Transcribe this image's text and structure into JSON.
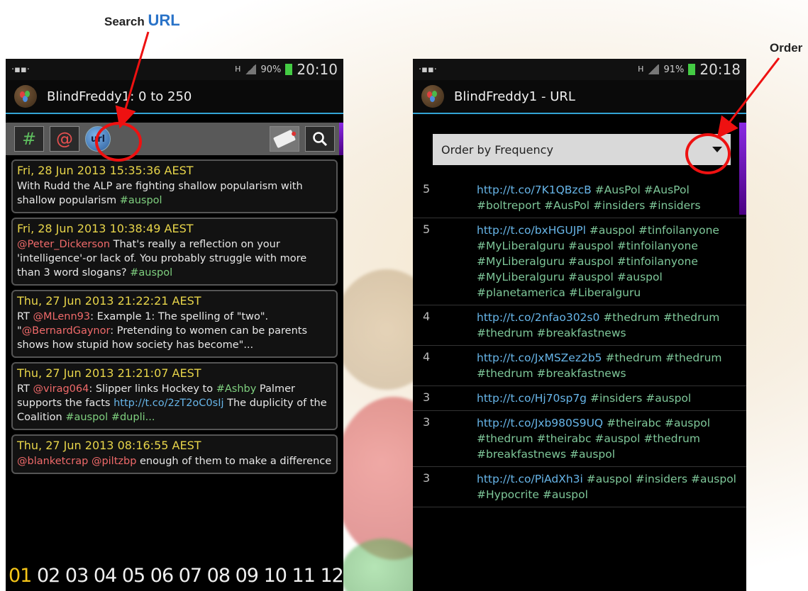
{
  "annotations": {
    "search_label": "Search",
    "url_label": "URL",
    "order_label": "Order"
  },
  "left_screen": {
    "status": {
      "network": "H",
      "battery": "90%",
      "time": "20:10"
    },
    "title": "BlindFreddy1: 0 to 250",
    "toolbar": {
      "hash_label": "#",
      "at_label": "@",
      "url_label": "url",
      "label_icon": "label-tag-icon",
      "search_icon": "search-icon"
    },
    "tweets": [
      {
        "date": "Fri, 28 Jun 2013 15:35:36 AEST",
        "parts": [
          {
            "t": "With Rudd the ALP are fighting shallow popularism with shallow popularism ",
            "c": ""
          },
          {
            "t": "#auspol",
            "c": "c-hash"
          }
        ]
      },
      {
        "date": "Fri, 28 Jun 2013 10:38:49 AEST",
        "parts": [
          {
            "t": "@Peter_Dickerson",
            "c": "c-mention"
          },
          {
            "t": " That's really a reflection on your 'intelligence'-or lack of. You probably struggle with more than 3 word slogans? ",
            "c": ""
          },
          {
            "t": "#auspol",
            "c": "c-hash"
          }
        ]
      },
      {
        "date": "Thu, 27 Jun 2013 21:22:21 AEST",
        "parts": [
          {
            "t": "RT ",
            "c": ""
          },
          {
            "t": "@MLenn93",
            "c": "c-mention"
          },
          {
            "t": ": Example 1: The spelling of \"two\". \"",
            "c": ""
          },
          {
            "t": "@BernardGaynor",
            "c": "c-mention"
          },
          {
            "t": ": Pretending to women can be parents shows how stupid how society has become\"...",
            "c": ""
          }
        ]
      },
      {
        "date": "Thu, 27 Jun 2013 21:21:07 AEST",
        "parts": [
          {
            "t": "RT ",
            "c": ""
          },
          {
            "t": "@virag064",
            "c": "c-mention"
          },
          {
            "t": ": Slipper links Hockey to ",
            "c": ""
          },
          {
            "t": "#Ashby",
            "c": "c-hash"
          },
          {
            "t": " Palmer supports the facts ",
            "c": ""
          },
          {
            "t": "http://t.co/2zT2oC0sIj",
            "c": "c-url"
          },
          {
            "t": " The duplicity of the Coalition ",
            "c": ""
          },
          {
            "t": "#auspol",
            "c": "c-hash"
          },
          {
            "t": " ",
            "c": ""
          },
          {
            "t": "#dupli...",
            "c": "c-hash"
          }
        ]
      },
      {
        "date": "Thu, 27 Jun 2013 08:16:55 AEST",
        "parts": [
          {
            "t": "@blanketcrap",
            "c": "c-mention"
          },
          {
            "t": " ",
            "c": ""
          },
          {
            "t": "@piltzbp",
            "c": "c-mention"
          },
          {
            "t": " enough of them to make a difference",
            "c": ""
          }
        ]
      }
    ],
    "pages": [
      "01",
      "02",
      "03",
      "04",
      "05",
      "06",
      "07",
      "08",
      "09",
      "10",
      "11",
      "12"
    ],
    "active_page": "01"
  },
  "right_screen": {
    "status": {
      "network": "H",
      "battery": "91%",
      "time": "20:18"
    },
    "title": "BlindFreddy1 - URL",
    "order_select": "Order by Frequency",
    "rows": [
      {
        "count": "5",
        "parts": [
          {
            "t": "http://t.co/7K1QBzcB",
            "c": "c-url"
          },
          {
            "t": " ",
            "c": ""
          },
          {
            "t": "#AusPol",
            "c": "c-hash"
          },
          {
            "t": " ",
            "c": ""
          },
          {
            "t": "#AusPol",
            "c": "c-hash"
          },
          {
            "t": " ",
            "c": ""
          },
          {
            "t": "#boltreport",
            "c": "c-hash"
          },
          {
            "t": " ",
            "c": ""
          },
          {
            "t": "#AusPol",
            "c": "c-hash"
          },
          {
            "t": " ",
            "c": ""
          },
          {
            "t": "#insiders",
            "c": "c-hash"
          },
          {
            "t": " ",
            "c": ""
          },
          {
            "t": "#insiders",
            "c": "c-hash"
          }
        ]
      },
      {
        "count": "5",
        "parts": [
          {
            "t": "http://t.co/bxHGUJPl",
            "c": "c-url"
          },
          {
            "t": " ",
            "c": ""
          },
          {
            "t": "#auspol",
            "c": "c-hash"
          },
          {
            "t": " ",
            "c": ""
          },
          {
            "t": "#tinfoilanyone",
            "c": "c-hash"
          },
          {
            "t": " ",
            "c": ""
          },
          {
            "t": "#MyLiberalguru",
            "c": "c-hash"
          },
          {
            "t": " ",
            "c": ""
          },
          {
            "t": "#auspol",
            "c": "c-hash"
          },
          {
            "t": " ",
            "c": ""
          },
          {
            "t": "#tinfoilanyone",
            "c": "c-hash"
          },
          {
            "t": " ",
            "c": ""
          },
          {
            "t": "#MyLiberalguru",
            "c": "c-hash"
          },
          {
            "t": " ",
            "c": ""
          },
          {
            "t": "#auspol",
            "c": "c-hash"
          },
          {
            "t": " ",
            "c": ""
          },
          {
            "t": "#tinfoilanyone",
            "c": "c-hash"
          },
          {
            "t": " ",
            "c": ""
          },
          {
            "t": "#MyLiberalguru",
            "c": "c-hash"
          },
          {
            "t": " ",
            "c": ""
          },
          {
            "t": "#auspol",
            "c": "c-hash"
          },
          {
            "t": " ",
            "c": ""
          },
          {
            "t": "#auspol",
            "c": "c-hash"
          },
          {
            "t": " ",
            "c": ""
          },
          {
            "t": "#planetamerica",
            "c": "c-hash"
          },
          {
            "t": " ",
            "c": ""
          },
          {
            "t": "#Liberalguru",
            "c": "c-hash"
          }
        ]
      },
      {
        "count": "4",
        "parts": [
          {
            "t": "http://t.co/2nfao302s0",
            "c": "c-url"
          },
          {
            "t": " ",
            "c": ""
          },
          {
            "t": "#thedrum",
            "c": "c-hash"
          },
          {
            "t": " ",
            "c": ""
          },
          {
            "t": "#thedrum",
            "c": "c-hash"
          },
          {
            "t": " ",
            "c": ""
          },
          {
            "t": "#thedrum",
            "c": "c-hash"
          },
          {
            "t": " ",
            "c": ""
          },
          {
            "t": "#breakfastnews",
            "c": "c-hash"
          }
        ]
      },
      {
        "count": "4",
        "parts": [
          {
            "t": "http://t.co/JxMSZez2b5",
            "c": "c-url"
          },
          {
            "t": " ",
            "c": ""
          },
          {
            "t": "#thedrum",
            "c": "c-hash"
          },
          {
            "t": " ",
            "c": ""
          },
          {
            "t": "#thedrum",
            "c": "c-hash"
          },
          {
            "t": " ",
            "c": ""
          },
          {
            "t": "#thedrum",
            "c": "c-hash"
          },
          {
            "t": " ",
            "c": ""
          },
          {
            "t": "#breakfastnews",
            "c": "c-hash"
          }
        ]
      },
      {
        "count": "3",
        "parts": [
          {
            "t": "http://t.co/Hj70sp7g",
            "c": "c-url"
          },
          {
            "t": " ",
            "c": ""
          },
          {
            "t": "#insiders",
            "c": "c-hash"
          },
          {
            "t": " ",
            "c": ""
          },
          {
            "t": "#auspol",
            "c": "c-hash"
          }
        ]
      },
      {
        "count": "3",
        "parts": [
          {
            "t": "http://t.co/Jxb980S9UQ",
            "c": "c-url"
          },
          {
            "t": " ",
            "c": ""
          },
          {
            "t": "#theirabc",
            "c": "c-hash"
          },
          {
            "t": " ",
            "c": ""
          },
          {
            "t": "#auspol",
            "c": "c-hash"
          },
          {
            "t": " ",
            "c": ""
          },
          {
            "t": "#thedrum",
            "c": "c-hash"
          },
          {
            "t": " ",
            "c": ""
          },
          {
            "t": "#theirabc",
            "c": "c-hash"
          },
          {
            "t": " ",
            "c": ""
          },
          {
            "t": "#auspol",
            "c": "c-hash"
          },
          {
            "t": " ",
            "c": ""
          },
          {
            "t": "#thedrum",
            "c": "c-hash"
          },
          {
            "t": " ",
            "c": ""
          },
          {
            "t": "#breakfastnews",
            "c": "c-hash"
          },
          {
            "t": " ",
            "c": ""
          },
          {
            "t": "#auspol",
            "c": "c-hash"
          }
        ]
      },
      {
        "count": "3",
        "parts": [
          {
            "t": "http://t.co/PiAdXh3i",
            "c": "c-url"
          },
          {
            "t": " ",
            "c": ""
          },
          {
            "t": "#auspol",
            "c": "c-hash"
          },
          {
            "t": " ",
            "c": ""
          },
          {
            "t": "#insiders",
            "c": "c-hash"
          },
          {
            "t": " ",
            "c": ""
          },
          {
            "t": "#auspol",
            "c": "c-hash"
          },
          {
            "t": " ",
            "c": ""
          },
          {
            "t": "#Hypocrite",
            "c": "c-hash"
          },
          {
            "t": " ",
            "c": ""
          },
          {
            "t": "#auspol",
            "c": "c-hash"
          }
        ]
      }
    ]
  }
}
